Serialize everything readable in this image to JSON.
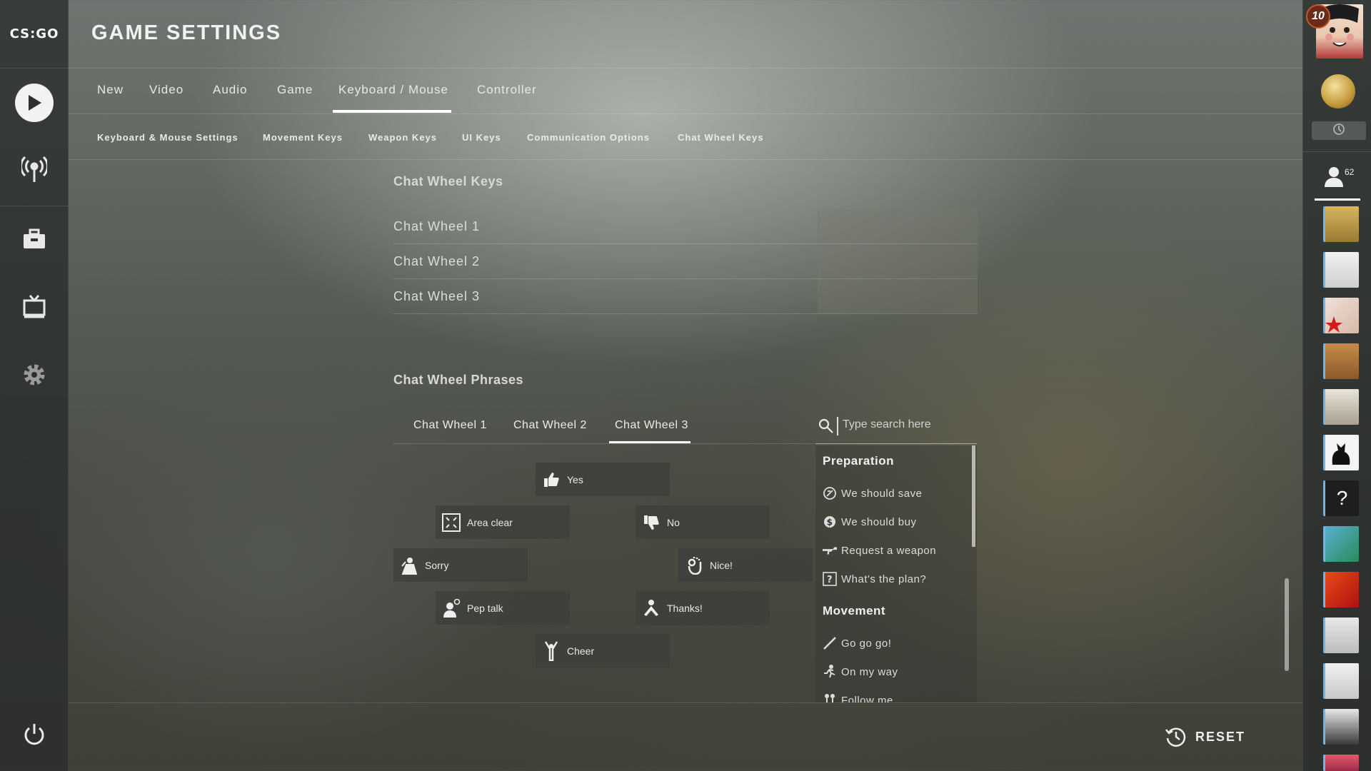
{
  "app": {
    "logo": "CS:GO",
    "page_title": "GAME SETTINGS"
  },
  "left_rail": {
    "icons": [
      "play-icon",
      "broadcast-icon",
      "inventory-icon",
      "watch-tv-icon",
      "gear-icon"
    ],
    "bottom_icon": "power-icon"
  },
  "main_tabs": [
    {
      "label": "New"
    },
    {
      "label": "Video"
    },
    {
      "label": "Audio"
    },
    {
      "label": "Game"
    },
    {
      "label": "Keyboard / Mouse",
      "active": true
    },
    {
      "label": "Controller"
    }
  ],
  "sub_tabs": [
    {
      "label": "Keyboard & Mouse Settings"
    },
    {
      "label": "Movement Keys"
    },
    {
      "label": "Weapon Keys"
    },
    {
      "label": "UI Keys"
    },
    {
      "label": "Communication Options"
    },
    {
      "label": "Chat Wheel Keys"
    }
  ],
  "keys_section": {
    "title": "Chat Wheel Keys",
    "rows": [
      {
        "label": "Chat Wheel 1",
        "binding": ""
      },
      {
        "label": "Chat Wheel 2",
        "binding": ""
      },
      {
        "label": "Chat Wheel 3",
        "binding": ""
      }
    ]
  },
  "phrases_section": {
    "title": "Chat Wheel Phrases",
    "tabs": [
      {
        "label": "Chat Wheel 1"
      },
      {
        "label": "Chat Wheel 2"
      },
      {
        "label": "Chat Wheel 3",
        "active": true
      }
    ],
    "slots": [
      {
        "label": "Yes",
        "icon": "thumbs-up-icon"
      },
      {
        "label": "Area clear",
        "icon": "area-clear-icon"
      },
      {
        "label": "No",
        "icon": "thumbs-down-icon"
      },
      {
        "label": "Sorry",
        "icon": "sorry-icon"
      },
      {
        "label": "Nice!",
        "icon": "ok-hand-icon"
      },
      {
        "label": "Pep talk",
        "icon": "pep-talk-icon"
      },
      {
        "label": "Thanks!",
        "icon": "thanks-icon"
      },
      {
        "label": "Cheer",
        "icon": "cheer-icon"
      }
    ],
    "search": {
      "placeholder": "Type search here",
      "value": ""
    },
    "list": [
      {
        "category": "Preparation",
        "items": [
          {
            "label": "We should save",
            "icon": "save-icon"
          },
          {
            "label": "We should buy",
            "icon": "dollar-icon"
          },
          {
            "label": "Request a weapon",
            "icon": "weapon-icon"
          },
          {
            "label": "What's the plan?",
            "icon": "question-icon"
          }
        ]
      },
      {
        "category": "Movement",
        "items": [
          {
            "label": "Go go go!",
            "icon": "go-icon"
          },
          {
            "label": "On my way",
            "icon": "running-icon"
          },
          {
            "label": "Follow me",
            "icon": "follow-icon"
          }
        ]
      }
    ]
  },
  "bottom": {
    "reset_label": "RESET"
  },
  "right_rail": {
    "level": "10",
    "friends_count": "62",
    "colors": {
      "friend_online": "#7bb3e0"
    }
  }
}
